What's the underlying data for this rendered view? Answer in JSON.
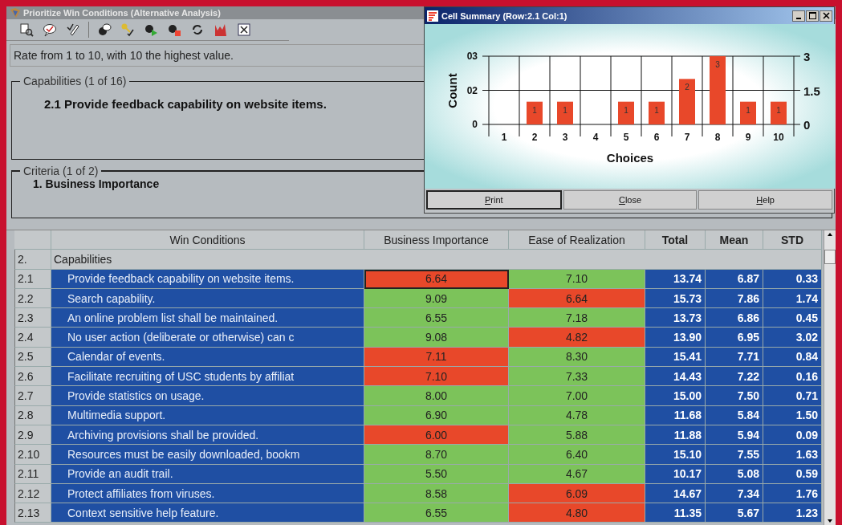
{
  "window": {
    "title": "Prioritize Win Conditions (Alternative Analysis)"
  },
  "instruction": "Rate from 1 to 10, with 10 the highest value.",
  "capability_group": {
    "legend": "Capabilities (1 of 16)",
    "item": "2.1 Provide feedback capability on website items."
  },
  "criteria_group": {
    "legend": "Criteria (1 of 2)",
    "item": "1. Business Importance"
  },
  "table": {
    "columns": [
      "Win Conditions",
      "Business Importance",
      "Ease of Realization",
      "Total",
      "Mean",
      "STD"
    ],
    "section": {
      "number": "2.",
      "label": "Capabilities"
    },
    "rows": [
      {
        "number": "2.1",
        "name": "Provide feedback capability on website items.",
        "business": {
          "value": "6.64",
          "color": "#e8482a",
          "selected": true
        },
        "ease": {
          "value": "7.10",
          "color": "#7cc35a",
          "selected": false
        },
        "total": "13.74",
        "mean": "6.87",
        "std": "0.33"
      },
      {
        "number": "2.2",
        "name": "Search capability.",
        "business": {
          "value": "9.09",
          "color": "#7cc35a",
          "selected": false
        },
        "ease": {
          "value": "6.64",
          "color": "#e8482a",
          "selected": false
        },
        "total": "15.73",
        "mean": "7.86",
        "std": "1.74"
      },
      {
        "number": "2.3",
        "name": "An online problem list shall be maintained.",
        "business": {
          "value": "6.55",
          "color": "#7cc35a",
          "selected": false
        },
        "ease": {
          "value": "7.18",
          "color": "#7cc35a",
          "selected": false
        },
        "total": "13.73",
        "mean": "6.86",
        "std": "0.45"
      },
      {
        "number": "2.4",
        "name": "No user action (deliberate or otherwise) can c",
        "business": {
          "value": "9.08",
          "color": "#7cc35a",
          "selected": false
        },
        "ease": {
          "value": "4.82",
          "color": "#e8482a",
          "selected": false
        },
        "total": "13.90",
        "mean": "6.95",
        "std": "3.02"
      },
      {
        "number": "2.5",
        "name": "Calendar of events.",
        "business": {
          "value": "7.11",
          "color": "#e8482a",
          "selected": false
        },
        "ease": {
          "value": "8.30",
          "color": "#7cc35a",
          "selected": false
        },
        "total": "15.41",
        "mean": "7.71",
        "std": "0.84"
      },
      {
        "number": "2.6",
        "name": "Facilitate recruiting of USC students by affiliat",
        "business": {
          "value": "7.10",
          "color": "#e8482a",
          "selected": false
        },
        "ease": {
          "value": "7.33",
          "color": "#7cc35a",
          "selected": false
        },
        "total": "14.43",
        "mean": "7.22",
        "std": "0.16"
      },
      {
        "number": "2.7",
        "name": "Provide statistics on usage.",
        "business": {
          "value": "8.00",
          "color": "#7cc35a",
          "selected": false
        },
        "ease": {
          "value": "7.00",
          "color": "#7cc35a",
          "selected": false
        },
        "total": "15.00",
        "mean": "7.50",
        "std": "0.71"
      },
      {
        "number": "2.8",
        "name": "Multimedia support.",
        "business": {
          "value": "6.90",
          "color": "#7cc35a",
          "selected": false
        },
        "ease": {
          "value": "4.78",
          "color": "#7cc35a",
          "selected": false
        },
        "total": "11.68",
        "mean": "5.84",
        "std": "1.50"
      },
      {
        "number": "2.9",
        "name": "Archiving provisions shall be provided.",
        "business": {
          "value": "6.00",
          "color": "#e8482a",
          "selected": false
        },
        "ease": {
          "value": "5.88",
          "color": "#7cc35a",
          "selected": false
        },
        "total": "11.88",
        "mean": "5.94",
        "std": "0.09"
      },
      {
        "number": "2.10",
        "name": "Resources must be easily downloaded, bookm",
        "business": {
          "value": "8.70",
          "color": "#7cc35a",
          "selected": false
        },
        "ease": {
          "value": "6.40",
          "color": "#7cc35a",
          "selected": false
        },
        "total": "15.10",
        "mean": "7.55",
        "std": "1.63"
      },
      {
        "number": "2.11",
        "name": "Provide an audit trail.",
        "business": {
          "value": "5.50",
          "color": "#7cc35a",
          "selected": false
        },
        "ease": {
          "value": "4.67",
          "color": "#7cc35a",
          "selected": false
        },
        "total": "10.17",
        "mean": "5.08",
        "std": "0.59"
      },
      {
        "number": "2.12",
        "name": "Protect affiliates from viruses.",
        "business": {
          "value": "8.58",
          "color": "#7cc35a",
          "selected": false
        },
        "ease": {
          "value": "6.09",
          "color": "#e8482a",
          "selected": false
        },
        "total": "14.67",
        "mean": "7.34",
        "std": "1.76"
      },
      {
        "number": "2.13",
        "name": "Context sensitive help feature.",
        "business": {
          "value": "6.55",
          "color": "#7cc35a",
          "selected": false
        },
        "ease": {
          "value": "4.80",
          "color": "#e8482a",
          "selected": false
        },
        "total": "11.35",
        "mean": "5.67",
        "std": "1.23"
      }
    ]
  },
  "popup": {
    "title": "Cell Summary (Row:2.1 Col:1)",
    "chart_data": {
      "type": "bar",
      "xlabel": "Choices",
      "ylabel": "Count",
      "categories": [
        "1",
        "2",
        "3",
        "4",
        "5",
        "6",
        "7",
        "8",
        "9",
        "10"
      ],
      "series": [
        {
          "color": "#e8482a",
          "values": [
            0,
            1,
            1,
            0,
            1,
            1,
            2,
            3,
            1,
            1
          ]
        }
      ],
      "ylim": [
        0,
        3
      ],
      "yticks": [
        {
          "value": 0,
          "label": "0"
        },
        {
          "value": 1.5,
          "label": "02"
        },
        {
          "value": 3,
          "label": "03"
        }
      ],
      "annotations": [
        "0",
        "1.5",
        "3"
      ],
      "value_labels": [
        null,
        "1",
        "1",
        null,
        "1",
        "1",
        "2",
        "3",
        "1",
        "1"
      ]
    },
    "buttons": [
      {
        "label": "Print",
        "focused": true
      },
      {
        "label": "Close",
        "focused": false
      },
      {
        "label": "Help",
        "focused": false
      }
    ]
  }
}
